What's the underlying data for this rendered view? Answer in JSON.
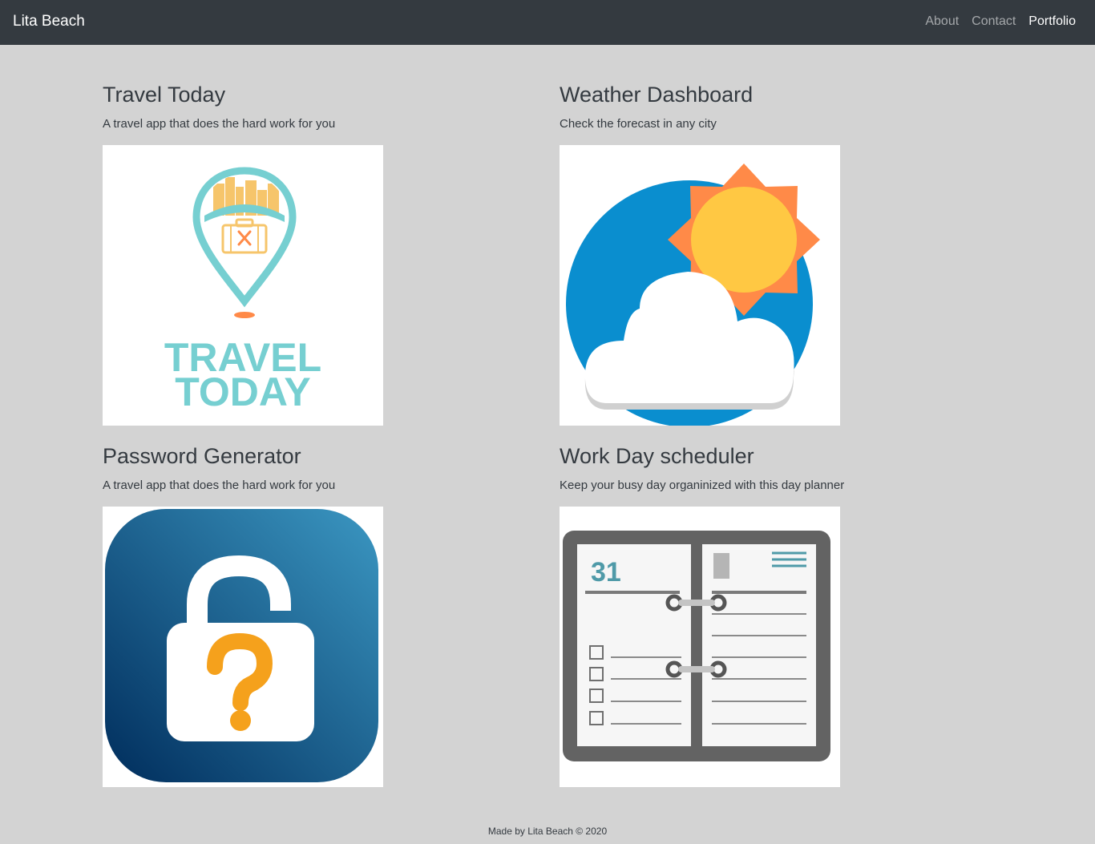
{
  "nav": {
    "brand": "Lita Beach",
    "links": [
      "About",
      "Contact",
      "Portfolio"
    ]
  },
  "projects": [
    {
      "title": "Travel Today",
      "description": "A travel app that does the hard work for you",
      "image_text": [
        "TRAVEL",
        "TODAY"
      ],
      "icon": "travel-pin-suitcase-logo"
    },
    {
      "title": "Weather Dashboard",
      "description": "Check the forecast in any city",
      "icon": "sun-cloud-weather-icon"
    },
    {
      "title": "Password Generator",
      "description": "A travel app that does the hard work for you",
      "icon": "padlock-question-icon"
    },
    {
      "title": "Work Day scheduler",
      "description": "Keep your busy day organinized with this day planner",
      "image_text": [
        "31"
      ],
      "icon": "day-planner-icon"
    }
  ],
  "footer": "Made by Lita Beach © 2020",
  "colors": {
    "navbar": "#343a40",
    "background": "#d3d3d3",
    "card": "#ffffff",
    "teal": "#76cfd1",
    "orange": "#ff8a48",
    "blue": "#0a8ecf",
    "navy": "#0d4d7e",
    "gold": "#f5a11c"
  }
}
